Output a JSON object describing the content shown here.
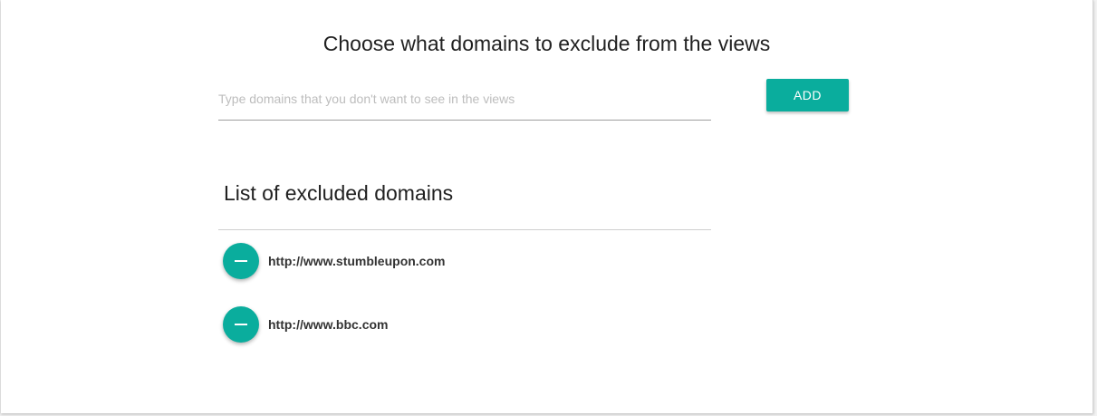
{
  "header": {
    "title": "Choose what domains to exclude from the views"
  },
  "domain_input": {
    "value": "",
    "placeholder": "Type domains that you don't want to see in the views"
  },
  "add_button": {
    "label": "ADD"
  },
  "excluded_list": {
    "title": "List of excluded domains",
    "items": [
      {
        "domain": "http://www.stumbleupon.com",
        "icon": "minus-icon"
      },
      {
        "domain": "http://www.bbc.com",
        "icon": "minus-icon"
      }
    ]
  },
  "colors": {
    "accent": "#0aad9d",
    "text": "#212121",
    "placeholder": "#bdbdbd"
  }
}
